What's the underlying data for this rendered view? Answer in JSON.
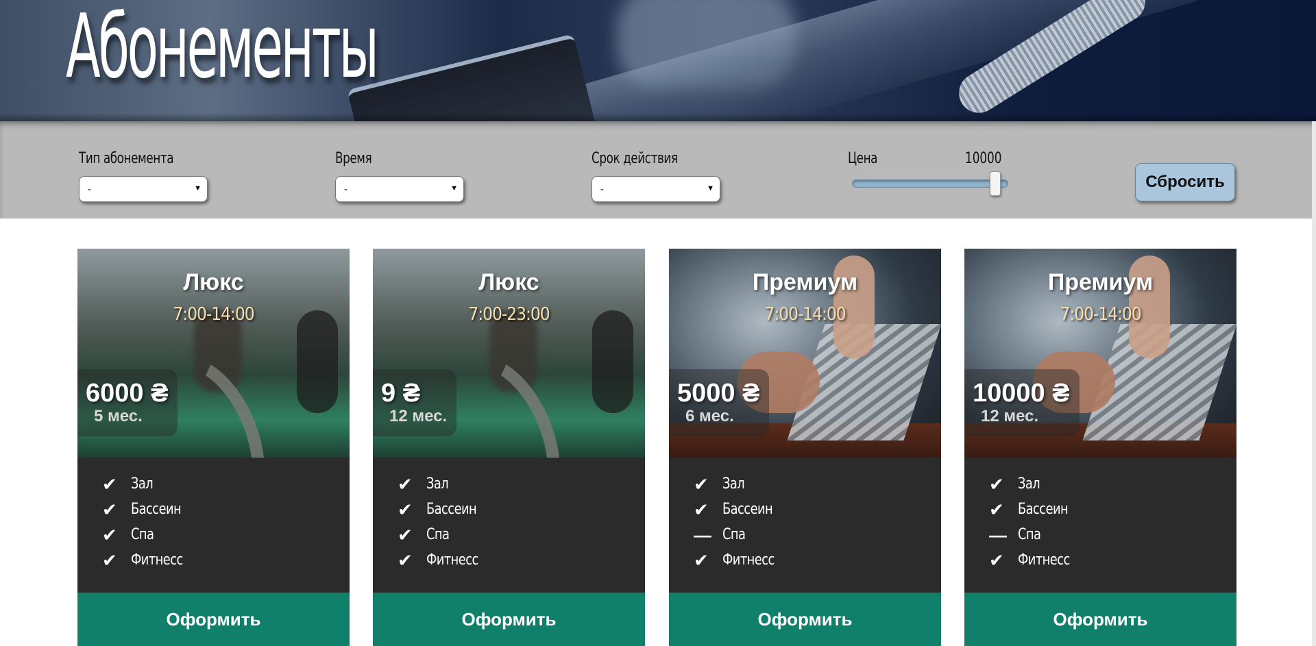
{
  "header": {
    "title": "Абонементы"
  },
  "filters": {
    "type": {
      "label": "Тип абонемента",
      "value": "-"
    },
    "time": {
      "label": "Время",
      "value": "-"
    },
    "duration": {
      "label": "Срок действия",
      "value": "-"
    },
    "price": {
      "label": "Цена",
      "value": "10000",
      "slider_level_percent": 100
    },
    "reset_label": "Сбросить"
  },
  "icons": {
    "dropdown": "triangle-down",
    "check": "checkmark",
    "dash": "dash"
  },
  "colors": {
    "filter_bar": "#b9b9b9",
    "card_body": "#2b2b2b",
    "order_button": "#10806b",
    "time_text": "#f6ddae",
    "reset_button": "#a9c6dc"
  },
  "cards": [
    {
      "type": "Люкс",
      "time": "7:00-14:00",
      "price": "6000 ₴",
      "duration": "5 мес.",
      "features": [
        {
          "label": "Зал",
          "included": true,
          "icon": "✔"
        },
        {
          "label": "Бассеин",
          "included": true,
          "icon": "✔"
        },
        {
          "label": "Спа",
          "included": true,
          "icon": "✔"
        },
        {
          "label": "Фитнесс",
          "included": true,
          "icon": "✔"
        }
      ],
      "button": "Оформить"
    },
    {
      "type": "Люкс",
      "time": "7:00-23:00",
      "price": "9 ₴",
      "duration": "12 мес.",
      "features": [
        {
          "label": "Зал",
          "included": true,
          "icon": "✔"
        },
        {
          "label": "Бассеин",
          "included": true,
          "icon": "✔"
        },
        {
          "label": "Спа",
          "included": true,
          "icon": "✔"
        },
        {
          "label": "Фитнесс",
          "included": true,
          "icon": "✔"
        }
      ],
      "button": "Оформить"
    },
    {
      "type": "Премиум",
      "time": "7:00-14:00",
      "price": "5000 ₴",
      "duration": "6 мес.",
      "features": [
        {
          "label": "Зал",
          "included": true,
          "icon": "✔"
        },
        {
          "label": "Бассеин",
          "included": true,
          "icon": "✔"
        },
        {
          "label": "Спа",
          "included": false,
          "icon": "—"
        },
        {
          "label": "Фитнесс",
          "included": true,
          "icon": "✔"
        }
      ],
      "button": "Оформить"
    },
    {
      "type": "Премиум",
      "time": "7:00-14:00",
      "price": "10000 ₴",
      "duration": "12 мес.",
      "features": [
        {
          "label": "Зал",
          "included": true,
          "icon": "✔"
        },
        {
          "label": "Бассеин",
          "included": true,
          "icon": "✔"
        },
        {
          "label": "Спа",
          "included": false,
          "icon": "—"
        },
        {
          "label": "Фитнесс",
          "included": true,
          "icon": "✔"
        }
      ],
      "button": "Оформить"
    }
  ]
}
